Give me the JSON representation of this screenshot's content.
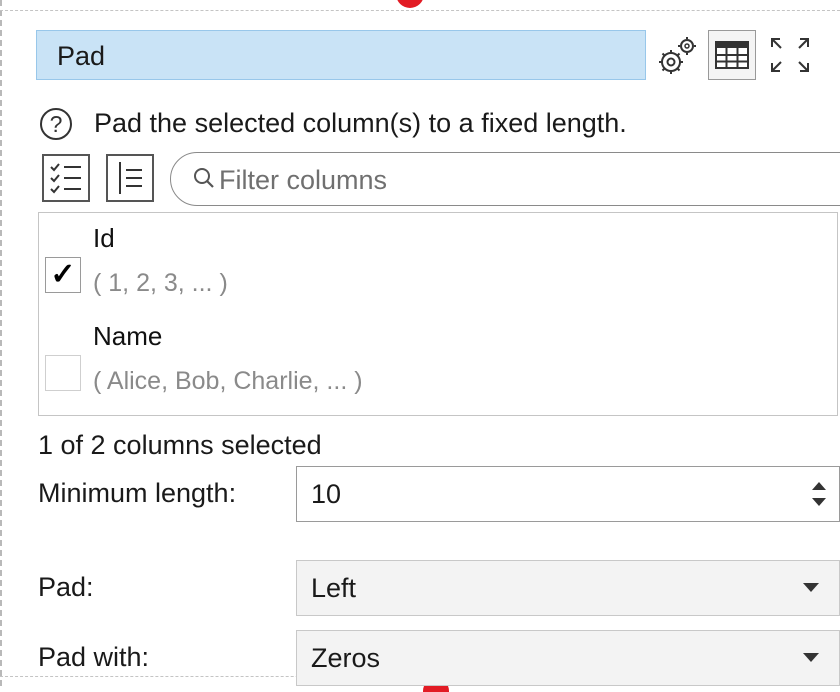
{
  "panel": {
    "title": "Pad",
    "description": "Pad the selected column(s) to a fixed length."
  },
  "toolbar": {
    "icons": [
      "gear-icon",
      "table-icon",
      "expand-icon"
    ]
  },
  "filter": {
    "placeholder": "Filter columns"
  },
  "columns": [
    {
      "name": "Id",
      "sample": "( 1, 2, 3, ... )",
      "checked": true
    },
    {
      "name": "Name",
      "sample": "( Alice, Bob, Charlie, ... )",
      "checked": false
    }
  ],
  "status": {
    "selected_count": "1 of 2 columns selected"
  },
  "form": {
    "minimum_length_label": "Minimum length:",
    "minimum_length_value": "10",
    "pad_label": "Pad:",
    "pad_value": "Left",
    "pad_with_label": "Pad with:",
    "pad_with_value": "Zeros"
  },
  "colors": {
    "title_bg": "#c9e3f6",
    "marker": "#e21b24"
  }
}
